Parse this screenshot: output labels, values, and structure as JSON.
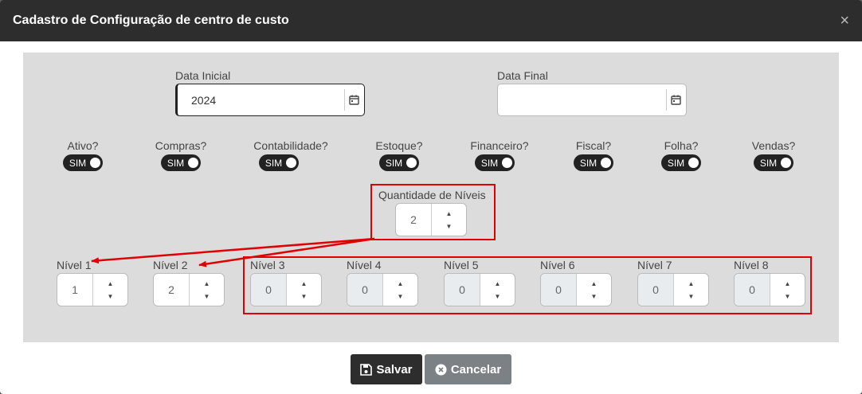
{
  "modal": {
    "title": "Cadastro de Configuração de centro de custo",
    "close": "×"
  },
  "dates": {
    "initial_label": "Data Inicial",
    "initial_value": "2024",
    "final_label": "Data Final",
    "final_value": ""
  },
  "toggles": [
    {
      "label": "Ativo?",
      "value": "SIM"
    },
    {
      "label": "Compras?",
      "value": "SIM"
    },
    {
      "label": "Contabilidade?",
      "value": "SIM"
    },
    {
      "label": "Estoque?",
      "value": "SIM"
    },
    {
      "label": "Financeiro?",
      "value": "SIM"
    },
    {
      "label": "Fiscal?",
      "value": "SIM"
    },
    {
      "label": "Folha?",
      "value": "SIM"
    },
    {
      "label": "Vendas?",
      "value": "SIM"
    }
  ],
  "quantity": {
    "label": "Quantidade de Níveis",
    "value": "2"
  },
  "levels": [
    {
      "label": "Nível 1",
      "value": "1"
    },
    {
      "label": "Nível 2",
      "value": "2"
    },
    {
      "label": "Nível 3",
      "value": "0"
    },
    {
      "label": "Nível 4",
      "value": "0"
    },
    {
      "label": "Nível 5",
      "value": "0"
    },
    {
      "label": "Nível 6",
      "value": "0"
    },
    {
      "label": "Nível 7",
      "value": "0"
    },
    {
      "label": "Nível 8",
      "value": "0"
    }
  ],
  "buttons": {
    "save": "Salvar",
    "cancel": "Cancelar"
  },
  "colors": {
    "header": "#2d2d2d",
    "annotation": "#e00000"
  }
}
